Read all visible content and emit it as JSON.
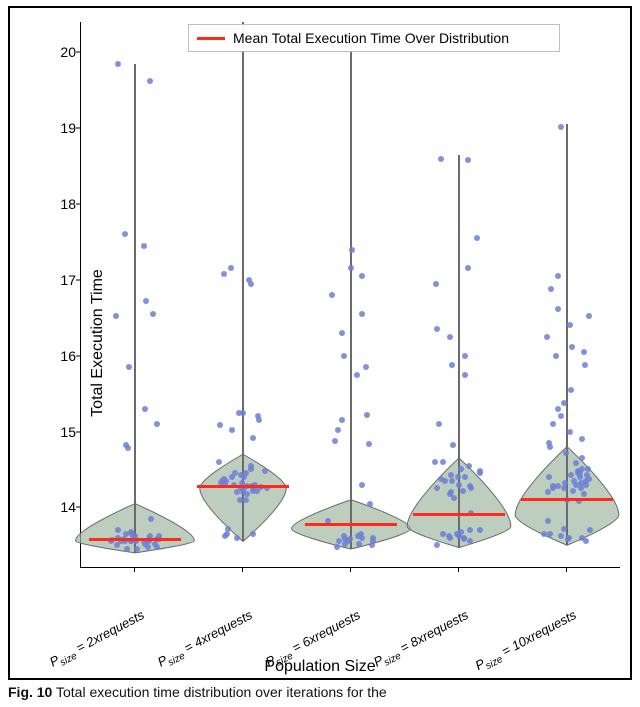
{
  "legend": {
    "label": "Mean Total Execution Time Over Distribution"
  },
  "axes": {
    "xlabel": "Population Size",
    "ylabel": "Total Execution Time",
    "ylim": [
      13.2,
      20.4
    ],
    "yticks": [
      14,
      15,
      16,
      17,
      18,
      19,
      20
    ]
  },
  "caption_prefix": "Fig. 10",
  "caption_text": " Total execution time distribution over iterations for the",
  "chart_data": {
    "type": "violin+strip",
    "xlabel": "Population Size",
    "ylabel": "Total Execution Time",
    "ylim": [
      13.2,
      20.4
    ],
    "categories": [
      "P_size = 2xrequests",
      "P_size = 4xrequests",
      "P_size = 6xrequests",
      "P_size = 8xrequests",
      "P_size = 10xrequests"
    ],
    "category_labels_rich": [
      {
        "prefix": "P",
        "sub": "size",
        "rest": " = 2xrequests"
      },
      {
        "prefix": "P",
        "sub": "size",
        "rest": " = 4xrequests"
      },
      {
        "prefix": "P",
        "sub": "size",
        "rest": " = 6xrequests"
      },
      {
        "prefix": "P",
        "sub": "size",
        "rest": " = 8xrequests"
      },
      {
        "prefix": "P",
        "sub": "size",
        "rest": " = 10xrequests"
      }
    ],
    "mean_values": [
      13.58,
      14.28,
      13.78,
      13.9,
      14.1
    ],
    "violin_shapes": [
      {
        "center": 13.56,
        "halfwidth": 0.55,
        "top": 14.05,
        "bottom": 13.4,
        "stem_top": 19.85,
        "stem_bottom": 13.4
      },
      {
        "center": 14.25,
        "halfwidth": 0.4,
        "top": 14.7,
        "bottom": 13.55,
        "stem_top": 20.4,
        "stem_bottom": 13.55
      },
      {
        "center": 13.72,
        "halfwidth": 0.55,
        "top": 14.1,
        "bottom": 13.45,
        "stem_top": 20.1,
        "stem_bottom": 13.45
      },
      {
        "center": 13.75,
        "halfwidth": 0.48,
        "top": 14.65,
        "bottom": 13.47,
        "stem_top": 18.65,
        "stem_bottom": 13.47
      },
      {
        "center": 13.9,
        "halfwidth": 0.48,
        "top": 14.8,
        "bottom": 13.5,
        "stem_top": 19.05,
        "stem_bottom": 13.5
      }
    ],
    "scatter": [
      [
        13.45,
        13.45,
        13.48,
        13.48,
        13.5,
        13.52,
        13.52,
        13.55,
        13.55,
        13.55,
        13.55,
        13.55,
        13.56,
        13.56,
        13.56,
        13.56,
        13.57,
        13.57,
        13.58,
        13.58,
        13.58,
        13.58,
        13.6,
        13.6,
        13.62,
        13.62,
        13.62,
        13.65,
        13.65,
        13.68,
        13.7,
        13.85,
        14.78,
        14.82,
        15.1,
        15.3,
        15.85,
        16.52,
        16.55,
        16.72,
        17.45,
        17.6,
        19.62,
        19.85
      ],
      [
        13.6,
        13.62,
        13.65,
        13.65,
        13.72,
        14.1,
        14.1,
        14.18,
        14.2,
        14.2,
        14.22,
        14.22,
        14.25,
        14.25,
        14.25,
        14.25,
        14.27,
        14.28,
        14.28,
        14.3,
        14.3,
        14.3,
        14.32,
        14.32,
        14.35,
        14.35,
        14.38,
        14.4,
        14.4,
        14.42,
        14.45,
        14.45,
        14.48,
        14.5,
        14.55,
        14.6,
        14.92,
        15.02,
        15.08,
        15.15,
        15.2,
        15.25,
        15.25,
        16.95,
        17.0,
        17.08,
        17.15
      ],
      [
        13.48,
        13.5,
        13.52,
        13.52,
        13.55,
        13.55,
        13.56,
        13.58,
        13.58,
        13.6,
        13.6,
        13.62,
        13.62,
        13.65,
        13.82,
        14.05,
        14.3,
        14.84,
        14.88,
        15.02,
        15.15,
        15.22,
        15.75,
        15.85,
        16.0,
        16.3,
        16.55,
        16.8,
        17.05,
        17.15,
        17.4,
        20.1
      ],
      [
        13.5,
        13.55,
        13.58,
        13.6,
        13.6,
        13.62,
        13.62,
        13.65,
        13.65,
        13.68,
        13.7,
        13.7,
        13.92,
        14.12,
        14.18,
        14.2,
        14.22,
        14.25,
        14.25,
        14.28,
        14.3,
        14.35,
        14.35,
        14.38,
        14.4,
        14.4,
        14.42,
        14.45,
        14.48,
        14.5,
        14.55,
        14.6,
        14.6,
        14.82,
        15.1,
        15.75,
        15.88,
        16.0,
        16.25,
        16.35,
        16.95,
        17.15,
        17.55,
        18.58,
        18.6
      ],
      [
        13.55,
        13.58,
        13.6,
        13.6,
        13.62,
        13.65,
        13.65,
        13.7,
        13.72,
        13.82,
        14.08,
        14.1,
        14.18,
        14.2,
        14.22,
        14.25,
        14.25,
        14.25,
        14.28,
        14.28,
        14.3,
        14.3,
        14.32,
        14.32,
        14.35,
        14.35,
        14.38,
        14.4,
        14.4,
        14.42,
        14.42,
        14.45,
        14.45,
        14.48,
        14.5,
        14.5,
        14.58,
        14.65,
        14.72,
        14.8,
        14.85,
        14.9,
        15.0,
        15.1,
        15.2,
        15.3,
        15.38,
        15.55,
        15.88,
        16.0,
        16.05,
        16.12,
        16.25,
        16.4,
        16.52,
        16.62,
        16.88,
        17.05,
        19.02
      ]
    ]
  }
}
